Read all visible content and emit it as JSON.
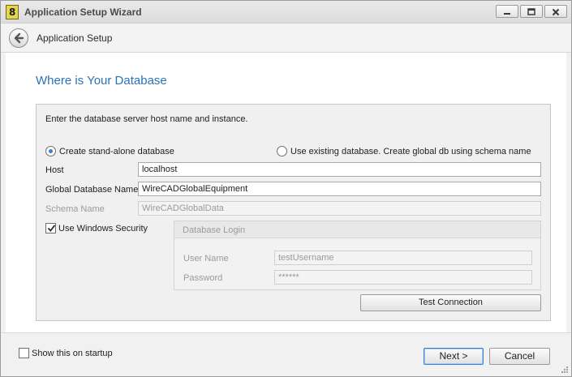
{
  "window": {
    "title": "Application Setup Wizard"
  },
  "header": {
    "title": "Application Setup"
  },
  "main": {
    "page_title": "Where is Your Database",
    "instructions": "Enter the database server host name and instance.",
    "radio_standalone": "Create stand-alone database",
    "radio_existing": "Use existing database. Create global db using schema name",
    "host_label": "Host",
    "host_value": "localhost",
    "global_db_label": "Global Database Name",
    "global_db_value": "WireCADGlobalEquipment",
    "schema_label": "Schema Name",
    "schema_value": "WireCADGlobalData",
    "windows_security_label": "Use Windows Security",
    "login": {
      "title": "Database Login",
      "username_label": "User Name",
      "username_value": "testUsername",
      "password_label": "Password",
      "password_value": "******"
    },
    "test_connection_label": "Test Connection"
  },
  "footer": {
    "show_startup_label": "Show this on startup",
    "next_label": "Next >",
    "cancel_label": "Cancel"
  },
  "state": {
    "standalone_selected": true,
    "windows_security_checked": true,
    "show_startup_checked": false
  },
  "colors": {
    "accent": "#2a73b8",
    "radio_dot": "#3f7fc2",
    "default_button_border": "#3c7fcb"
  }
}
